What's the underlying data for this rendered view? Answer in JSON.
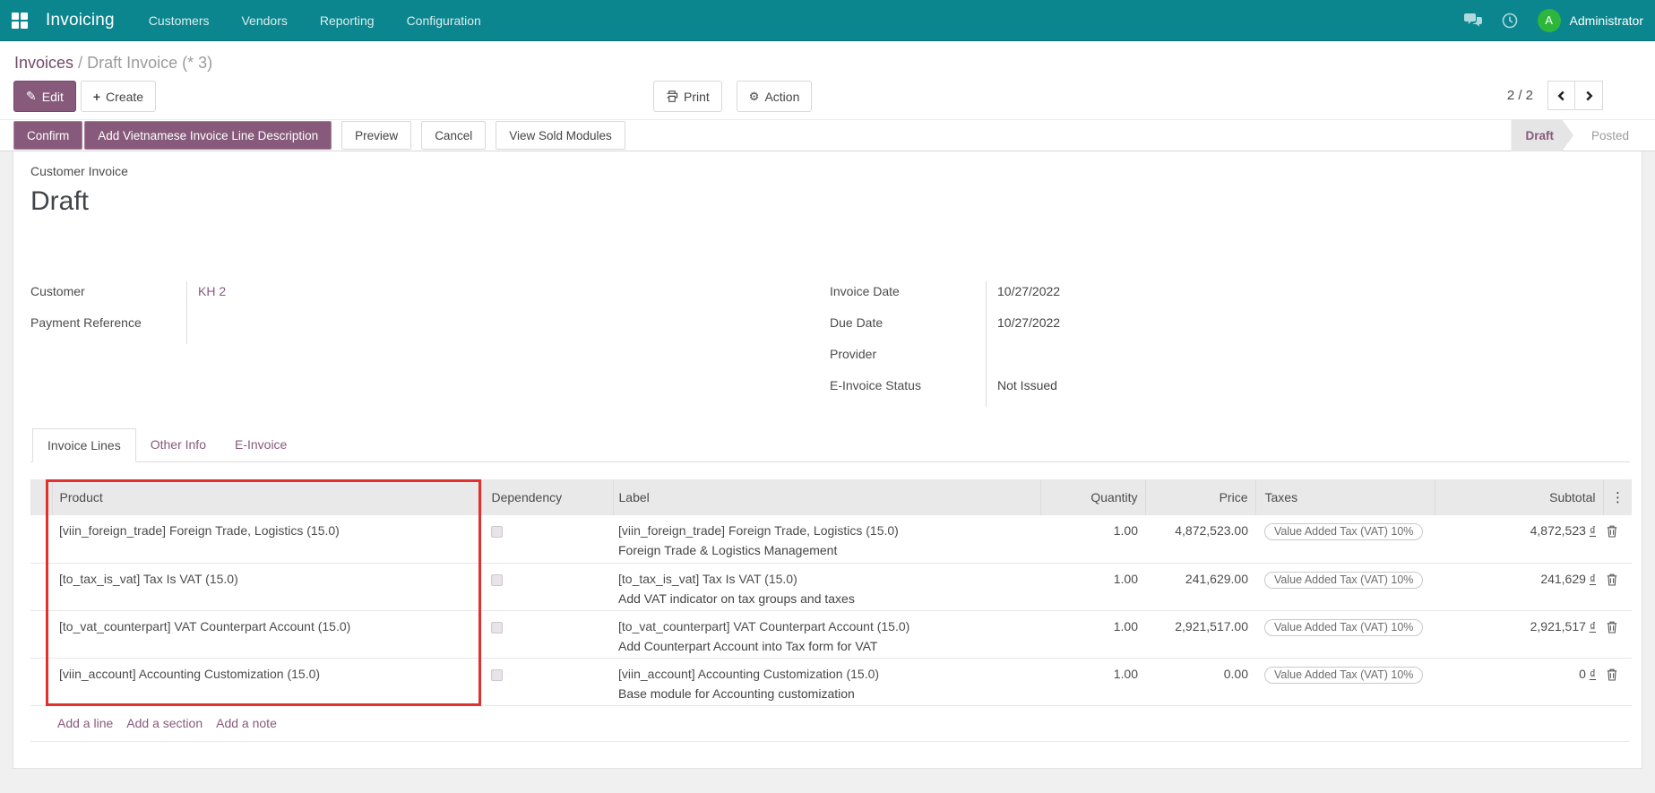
{
  "nav": {
    "app_name": "Invoicing",
    "menus": [
      "Customers",
      "Vendors",
      "Reporting",
      "Configuration"
    ],
    "user_name": "Administrator",
    "avatar_initial": "A"
  },
  "breadcrumb": {
    "parent": "Invoices",
    "separator": "/",
    "current": "Draft Invoice (* 3)"
  },
  "control_panel": {
    "edit_label": "Edit",
    "create_label": "Create",
    "print_label": "Print",
    "action_label": "Action",
    "pager_text": "2 / 2"
  },
  "statusbar": {
    "buttons": [
      {
        "label": "Confirm",
        "style": "primary"
      },
      {
        "label": "Add Vietnamese Invoice Line Description",
        "style": "primary"
      },
      {
        "label": "Preview",
        "style": "secondary"
      },
      {
        "label": "Cancel",
        "style": "secondary"
      },
      {
        "label": "View Sold Modules",
        "style": "secondary"
      }
    ],
    "states": [
      {
        "label": "Draft",
        "active": true
      },
      {
        "label": "Posted",
        "active": false
      }
    ]
  },
  "sheet": {
    "doc_type": "Customer Invoice",
    "title": "Draft",
    "fields_left": [
      {
        "label": "Customer",
        "value": "KH 2"
      },
      {
        "label": "Payment Reference",
        "value": ""
      }
    ],
    "fields_right": [
      {
        "label": "Invoice Date",
        "value": "10/27/2022"
      },
      {
        "label": "Due Date",
        "value": "10/27/2022"
      },
      {
        "label": "Provider",
        "value": ""
      },
      {
        "label": "E-Invoice Status",
        "value": "Not Issued"
      }
    ],
    "tabs": [
      {
        "label": "Invoice Lines",
        "active": true
      },
      {
        "label": "Other Info",
        "active": false
      },
      {
        "label": "E-Invoice",
        "active": false
      }
    ],
    "table": {
      "headers": [
        "Product",
        "Dependency",
        "Label",
        "Quantity",
        "Price",
        "Taxes",
        "Subtotal"
      ],
      "options_icon": "⋮",
      "rows": [
        {
          "product": "[viin_foreign_trade] Foreign Trade, Logistics (15.0)",
          "dependency_checked": false,
          "label_line1": "[viin_foreign_trade] Foreign Trade, Logistics (15.0)",
          "label_line2": "Foreign Trade & Logistics Management",
          "quantity": "1.00",
          "price": "4,872,523.00",
          "tax": "Value Added Tax (VAT) 10%",
          "subtotal": "4,872,523",
          "currency": "₫"
        },
        {
          "product": "[to_tax_is_vat] Tax Is VAT (15.0)",
          "dependency_checked": false,
          "label_line1": "[to_tax_is_vat] Tax Is VAT (15.0)",
          "label_line2": "Add VAT indicator on tax groups and taxes",
          "quantity": "1.00",
          "price": "241,629.00",
          "tax": "Value Added Tax (VAT) 10%",
          "subtotal": "241,629",
          "currency": "₫"
        },
        {
          "product": "[to_vat_counterpart] VAT Counterpart Account (15.0)",
          "dependency_checked": false,
          "label_line1": "[to_vat_counterpart] VAT Counterpart Account (15.0)",
          "label_line2": "Add Counterpart Account into Tax form for VAT",
          "quantity": "1.00",
          "price": "2,921,517.00",
          "tax": "Value Added Tax (VAT) 10%",
          "subtotal": "2,921,517",
          "currency": "₫"
        },
        {
          "product": "[viin_account] Accounting Customization (15.0)",
          "dependency_checked": false,
          "label_line1": "[viin_account] Accounting Customization (15.0)",
          "label_line2": "Base module for Accounting customization",
          "quantity": "1.00",
          "price": "0.00",
          "tax": "Value Added Tax (VAT) 10%",
          "subtotal": "0",
          "currency": "₫"
        }
      ],
      "footer_links": [
        "Add a line",
        "Add a section",
        "Add a note"
      ]
    }
  },
  "icons": {
    "edit": "✎",
    "create": "+",
    "action_gear": "⚙"
  },
  "colors": {
    "navbar_teal": "#0c868e",
    "primary_purple": "#875A7B",
    "breadcrumb_purple": "#714B67",
    "avatar_green": "#2eb53c",
    "annotation_red": "#e0312e",
    "header_gray": "#e9e9e9"
  }
}
